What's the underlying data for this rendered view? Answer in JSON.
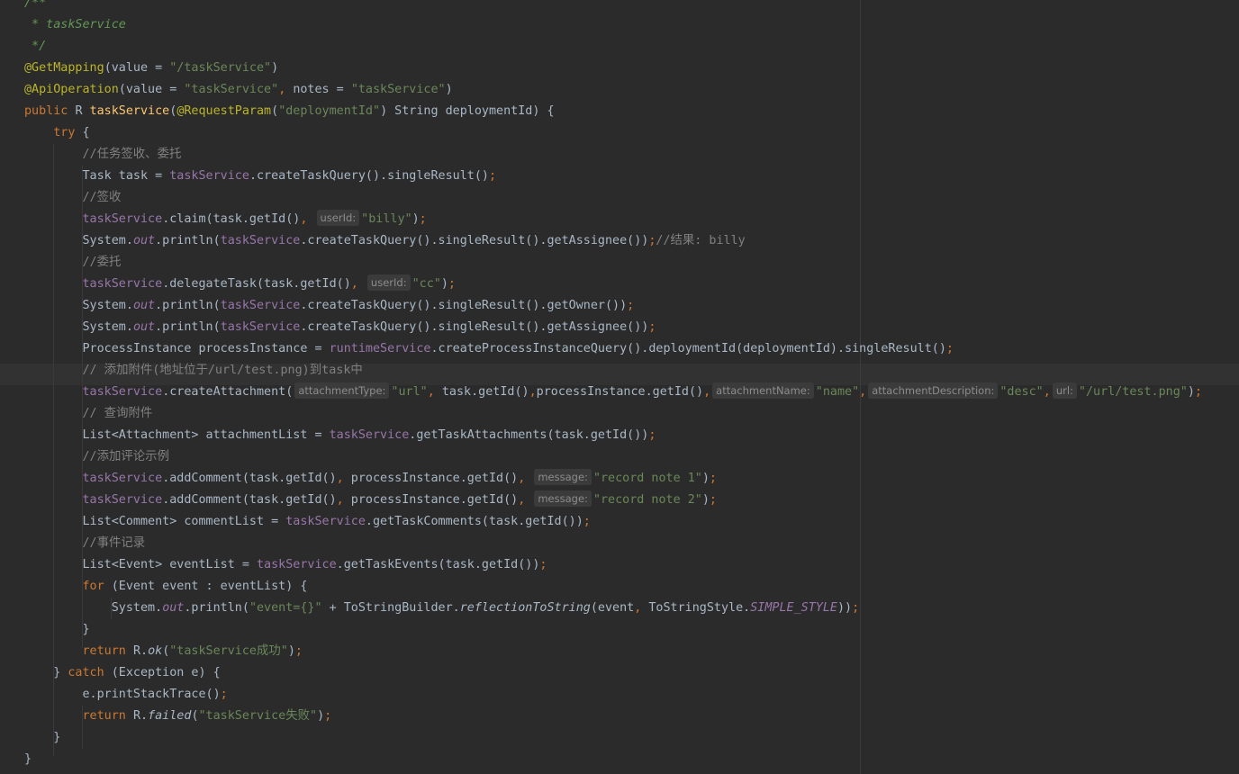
{
  "theme": {
    "background": "#2b2b2b",
    "default_text": "#a9b7c6",
    "keyword": "#cc7832",
    "string": "#6a8759",
    "comment": "#808080",
    "doc_comment": "#629755",
    "annotation": "#bbb529",
    "field": "#9876aa",
    "method_declaration": "#ffc66d"
  },
  "lines": [
    [
      {
        "t": "doc",
        "v": "/**"
      }
    ],
    [
      {
        "t": "doc",
        "v": " * taskService"
      }
    ],
    [
      {
        "t": "doc",
        "v": " */"
      }
    ],
    [
      {
        "t": "ann",
        "v": "@GetMapping"
      },
      {
        "t": "plain",
        "v": "(value = "
      },
      {
        "t": "str",
        "v": "\"/taskService\""
      },
      {
        "t": "plain",
        "v": ")"
      }
    ],
    [
      {
        "t": "ann",
        "v": "@ApiOperation"
      },
      {
        "t": "plain",
        "v": "(value = "
      },
      {
        "t": "str",
        "v": "\"taskService\""
      },
      {
        "t": "kw",
        "v": ", "
      },
      {
        "t": "plain",
        "v": "notes = "
      },
      {
        "t": "str",
        "v": "\"taskService\""
      },
      {
        "t": "plain",
        "v": ")"
      }
    ],
    [
      {
        "t": "kw",
        "v": "public "
      },
      {
        "t": "plain",
        "v": "R "
      },
      {
        "t": "method",
        "v": "taskService"
      },
      {
        "t": "plain",
        "v": "("
      },
      {
        "t": "ann",
        "v": "@RequestParam"
      },
      {
        "t": "plain",
        "v": "("
      },
      {
        "t": "str",
        "v": "\"deploymentId\""
      },
      {
        "t": "plain",
        "v": ") String deploymentId) {"
      }
    ],
    [
      {
        "t": "plain",
        "v": "    "
      },
      {
        "t": "kw",
        "v": "try "
      },
      {
        "t": "plain",
        "v": "{"
      }
    ],
    [
      {
        "t": "plain",
        "v": "        "
      },
      {
        "t": "cmt",
        "v": "//任务签收、委托"
      }
    ],
    [
      {
        "t": "plain",
        "v": "        Task task = "
      },
      {
        "t": "field",
        "v": "taskService"
      },
      {
        "t": "plain",
        "v": ".createTaskQuery().singleResult()"
      },
      {
        "t": "kw",
        "v": ";"
      }
    ],
    [
      {
        "t": "plain",
        "v": "        "
      },
      {
        "t": "cmt",
        "v": "//签收"
      }
    ],
    [
      {
        "t": "plain",
        "v": "        "
      },
      {
        "t": "field",
        "v": "taskService"
      },
      {
        "t": "plain",
        "v": ".claim(task.getId()"
      },
      {
        "t": "kw",
        "v": ", "
      },
      {
        "t": "hint",
        "v": "userId:"
      },
      {
        "t": "str",
        "v": "\"billy\""
      },
      {
        "t": "plain",
        "v": ")"
      },
      {
        "t": "kw",
        "v": ";"
      }
    ],
    [
      {
        "t": "plain",
        "v": "        System."
      },
      {
        "t": "static",
        "v": "out"
      },
      {
        "t": "plain",
        "v": ".println("
      },
      {
        "t": "field",
        "v": "taskService"
      },
      {
        "t": "plain",
        "v": ".createTaskQuery().singleResult().getAssignee())"
      },
      {
        "t": "kw",
        "v": ";"
      },
      {
        "t": "cmt",
        "v": "//结果: billy"
      }
    ],
    [
      {
        "t": "plain",
        "v": "        "
      },
      {
        "t": "cmt",
        "v": "//委托"
      }
    ],
    [
      {
        "t": "plain",
        "v": "        "
      },
      {
        "t": "field",
        "v": "taskService"
      },
      {
        "t": "plain",
        "v": ".delegateTask(task.getId()"
      },
      {
        "t": "kw",
        "v": ", "
      },
      {
        "t": "hint",
        "v": "userId:"
      },
      {
        "t": "str",
        "v": "\"cc\""
      },
      {
        "t": "plain",
        "v": ")"
      },
      {
        "t": "kw",
        "v": ";"
      }
    ],
    [
      {
        "t": "plain",
        "v": "        System."
      },
      {
        "t": "static",
        "v": "out"
      },
      {
        "t": "plain",
        "v": ".println("
      },
      {
        "t": "field",
        "v": "taskService"
      },
      {
        "t": "plain",
        "v": ".createTaskQuery().singleResult().getOwner())"
      },
      {
        "t": "kw",
        "v": ";"
      }
    ],
    [
      {
        "t": "plain",
        "v": "        System."
      },
      {
        "t": "static",
        "v": "out"
      },
      {
        "t": "plain",
        "v": ".println("
      },
      {
        "t": "field",
        "v": "taskService"
      },
      {
        "t": "plain",
        "v": ".createTaskQuery().singleResult().getAssignee())"
      },
      {
        "t": "kw",
        "v": ";"
      }
    ],
    [
      {
        "t": "plain",
        "v": "        ProcessInstance processInstance = "
      },
      {
        "t": "field",
        "v": "runtimeService"
      },
      {
        "t": "plain",
        "v": ".createProcessInstanceQuery().deploymentId(deploymentId).singleResult()"
      },
      {
        "t": "kw",
        "v": ";"
      }
    ],
    [
      {
        "t": "plain",
        "v": "        "
      },
      {
        "t": "cmt",
        "v": "// 添加附件(地址位于/url/test.png)到task中"
      }
    ],
    [
      {
        "t": "plain",
        "v": "        "
      },
      {
        "t": "field",
        "v": "taskService"
      },
      {
        "t": "plain",
        "v": ".createAttachment("
      },
      {
        "t": "hint",
        "v": "attachmentType:"
      },
      {
        "t": "str",
        "v": "\"url\""
      },
      {
        "t": "kw",
        "v": ", "
      },
      {
        "t": "plain",
        "v": "task.getId()"
      },
      {
        "t": "kw",
        "v": ","
      },
      {
        "t": "plain",
        "v": "processInstance.getId()"
      },
      {
        "t": "kw",
        "v": ","
      },
      {
        "t": "hint",
        "v": "attachmentName:"
      },
      {
        "t": "str",
        "v": "\"name\""
      },
      {
        "t": "kw",
        "v": ","
      },
      {
        "t": "hint",
        "v": "attachmentDescription:"
      },
      {
        "t": "str",
        "v": "\"desc\""
      },
      {
        "t": "kw",
        "v": ","
      },
      {
        "t": "hint",
        "v": "url:"
      },
      {
        "t": "str",
        "v": "\"/url/test.png\""
      },
      {
        "t": "plain",
        "v": ")"
      },
      {
        "t": "kw",
        "v": ";"
      }
    ],
    [
      {
        "t": "plain",
        "v": "        "
      },
      {
        "t": "cmt",
        "v": "// 查询附件"
      }
    ],
    [
      {
        "t": "plain",
        "v": "        List<Attachment> attachmentList = "
      },
      {
        "t": "field",
        "v": "taskService"
      },
      {
        "t": "plain",
        "v": ".getTaskAttachments(task.getId())"
      },
      {
        "t": "kw",
        "v": ";"
      }
    ],
    [
      {
        "t": "plain",
        "v": "        "
      },
      {
        "t": "cmt",
        "v": "//添加评论示例"
      }
    ],
    [
      {
        "t": "plain",
        "v": "        "
      },
      {
        "t": "field",
        "v": "taskService"
      },
      {
        "t": "plain",
        "v": ".addComment(task.getId()"
      },
      {
        "t": "kw",
        "v": ", "
      },
      {
        "t": "plain",
        "v": "processInstance.getId()"
      },
      {
        "t": "kw",
        "v": ", "
      },
      {
        "t": "hint",
        "v": "message:"
      },
      {
        "t": "str",
        "v": "\"record note 1\""
      },
      {
        "t": "plain",
        "v": ")"
      },
      {
        "t": "kw",
        "v": ";"
      }
    ],
    [
      {
        "t": "plain",
        "v": "        "
      },
      {
        "t": "field",
        "v": "taskService"
      },
      {
        "t": "plain",
        "v": ".addComment(task.getId()"
      },
      {
        "t": "kw",
        "v": ", "
      },
      {
        "t": "plain",
        "v": "processInstance.getId()"
      },
      {
        "t": "kw",
        "v": ", "
      },
      {
        "t": "hint",
        "v": "message:"
      },
      {
        "t": "str",
        "v": "\"record note 2\""
      },
      {
        "t": "plain",
        "v": ")"
      },
      {
        "t": "kw",
        "v": ";"
      }
    ],
    [
      {
        "t": "plain",
        "v": "        List<Comment> commentList = "
      },
      {
        "t": "field",
        "v": "taskService"
      },
      {
        "t": "plain",
        "v": ".getTaskComments(task.getId())"
      },
      {
        "t": "kw",
        "v": ";"
      }
    ],
    [
      {
        "t": "plain",
        "v": "        "
      },
      {
        "t": "cmt",
        "v": "//事件记录"
      }
    ],
    [
      {
        "t": "plain",
        "v": "        List<Event> eventList = "
      },
      {
        "t": "field",
        "v": "taskService"
      },
      {
        "t": "plain",
        "v": ".getTaskEvents(task.getId())"
      },
      {
        "t": "kw",
        "v": ";"
      }
    ],
    [
      {
        "t": "plain",
        "v": "        "
      },
      {
        "t": "kw",
        "v": "for "
      },
      {
        "t": "plain",
        "v": "(Event event : eventList) {"
      }
    ],
    [
      {
        "t": "plain",
        "v": "            System."
      },
      {
        "t": "static",
        "v": "out"
      },
      {
        "t": "plain",
        "v": ".println("
      },
      {
        "t": "str",
        "v": "\"event={}\""
      },
      {
        "t": "plain",
        "v": " + ToStringBuilder."
      },
      {
        "t": "italic",
        "v": "reflectionToString"
      },
      {
        "t": "plain",
        "v": "(event"
      },
      {
        "t": "kw",
        "v": ", "
      },
      {
        "t": "plain",
        "v": "ToStringStyle."
      },
      {
        "t": "const",
        "v": "SIMPLE_STYLE"
      },
      {
        "t": "plain",
        "v": "))"
      },
      {
        "t": "kw",
        "v": ";"
      }
    ],
    [
      {
        "t": "plain",
        "v": "        }"
      }
    ],
    [
      {
        "t": "plain",
        "v": "        "
      },
      {
        "t": "kw",
        "v": "return "
      },
      {
        "t": "plain",
        "v": "R."
      },
      {
        "t": "italic",
        "v": "ok"
      },
      {
        "t": "plain",
        "v": "("
      },
      {
        "t": "str",
        "v": "\"taskService成功\""
      },
      {
        "t": "plain",
        "v": ")"
      },
      {
        "t": "kw",
        "v": ";"
      }
    ],
    [
      {
        "t": "plain",
        "v": "    } "
      },
      {
        "t": "kw",
        "v": "catch "
      },
      {
        "t": "plain",
        "v": "(Exception e) {"
      }
    ],
    [
      {
        "t": "plain",
        "v": "        e.printStackTrace()"
      },
      {
        "t": "kw",
        "v": ";"
      }
    ],
    [
      {
        "t": "plain",
        "v": "        "
      },
      {
        "t": "kw",
        "v": "return "
      },
      {
        "t": "plain",
        "v": "R."
      },
      {
        "t": "italic",
        "v": "failed"
      },
      {
        "t": "plain",
        "v": "("
      },
      {
        "t": "str",
        "v": "\"taskService失败\""
      },
      {
        "t": "plain",
        "v": ")"
      },
      {
        "t": "kw",
        "v": ";"
      }
    ],
    [
      {
        "t": "plain",
        "v": "    }"
      }
    ],
    [
      {
        "t": "plain",
        "v": "}"
      }
    ]
  ]
}
